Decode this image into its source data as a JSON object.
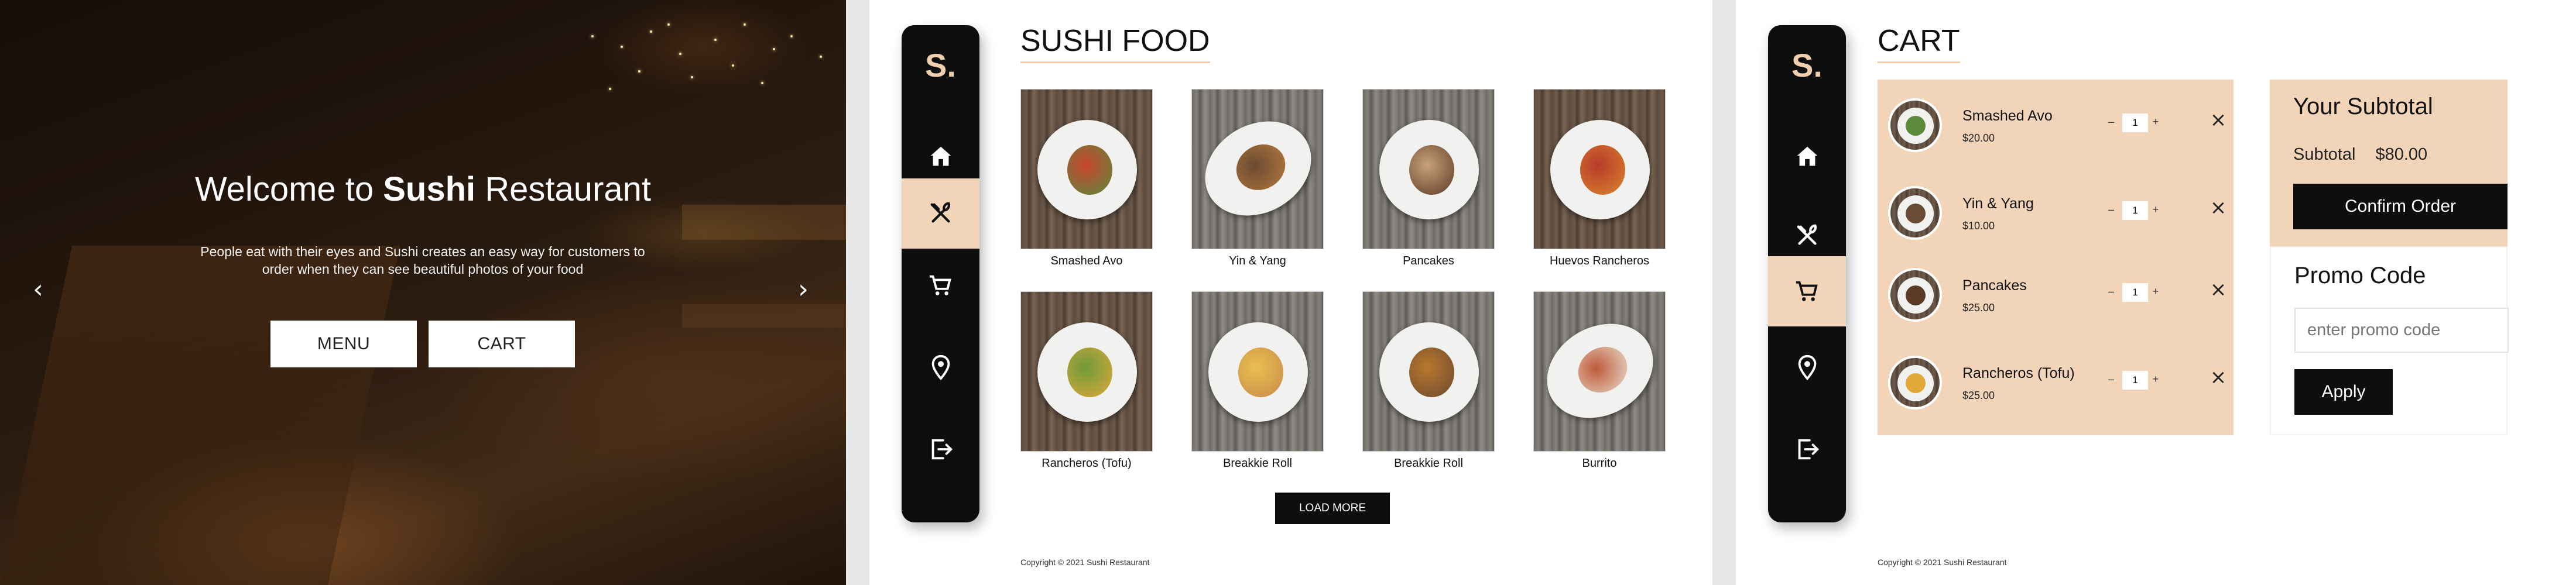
{
  "hero": {
    "title_prefix": "Welcome to ",
    "title_bold": "Sushi",
    "title_suffix": " Restaurant",
    "subtitle": "People eat with their eyes and Sushi creates an easy way for customers to order when they can see beautiful photos of your food",
    "menu_button": "MENU",
    "cart_button": "CART",
    "prev_arrow": "‹",
    "next_arrow": "›"
  },
  "brand": {
    "logo": "S.",
    "accent": "#f2d5b9",
    "dark": "#0e0e0e"
  },
  "sidebar_icons": [
    "home-icon",
    "utensils-icon",
    "cart-icon",
    "location-pin-icon",
    "logout-icon"
  ],
  "menu_page": {
    "title": "SUSHI FOOD",
    "items": [
      {
        "name": "Smashed Avo"
      },
      {
        "name": "Yin & Yang"
      },
      {
        "name": "Pancakes"
      },
      {
        "name": "Huevos Rancheros"
      },
      {
        "name": "Rancheros (Tofu)"
      },
      {
        "name": "Breakkie Roll"
      },
      {
        "name": "Breakkie Roll"
      },
      {
        "name": "Burrito"
      }
    ],
    "load_more": "LOAD MORE",
    "copyright": "Copyright © 2021 Sushi Restaurant"
  },
  "cart_page": {
    "title": "CART",
    "items": [
      {
        "name": "Smashed Avo",
        "price": "$20.00",
        "qty": "1"
      },
      {
        "name": "Yin & Yang",
        "price": "$10.00",
        "qty": "1"
      },
      {
        "name": "Pancakes",
        "price": "$25.00",
        "qty": "1"
      },
      {
        "name": "Rancheros (Tofu)",
        "price": "$25.00",
        "qty": "1"
      }
    ],
    "minus": "–",
    "plus": "+",
    "remove": "×",
    "subtotal_heading": "Your Subtotal",
    "subtotal_label": "Subtotal",
    "subtotal_value": "$80.00",
    "confirm": "Confirm Order",
    "promo_heading": "Promo Code",
    "promo_placeholder": "enter promo code",
    "apply": "Apply",
    "copyright": "Copyright © 2021 Sushi Restaurant"
  }
}
